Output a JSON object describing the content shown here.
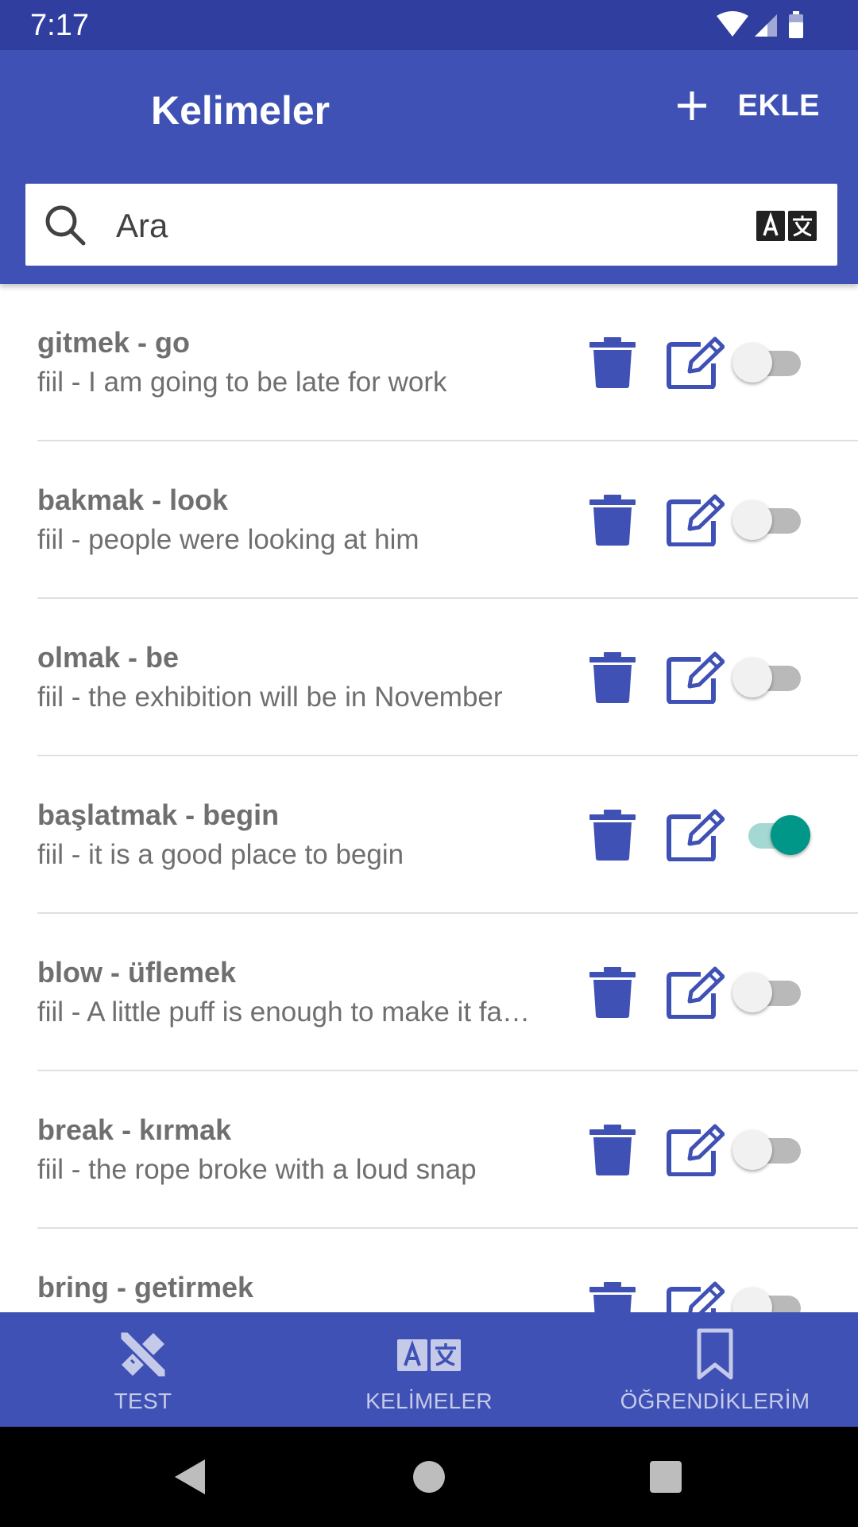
{
  "status_bar": {
    "time": "7:17"
  },
  "app_bar": {
    "title": "Kelimeler",
    "add_label": "EKLE"
  },
  "search": {
    "placeholder": "Ara"
  },
  "words": [
    {
      "title": "gitmek - go",
      "description": "fiil - I am going to be late for work",
      "learned": false
    },
    {
      "title": "bakmak - look",
      "description": "fiil - people were looking at him",
      "learned": false
    },
    {
      "title": "olmak - be",
      "description": "fiil - the exhibition will be in November",
      "learned": false
    },
    {
      "title": "başlatmak - begin",
      "description": "fiil - it is a good place to begin",
      "learned": true
    },
    {
      "title": "blow - üflemek",
      "description": "fiil - A little puff is enough to make it fa…",
      "learned": false
    },
    {
      "title": "break - kırmak",
      "description": "fiil - the rope broke with a loud snap",
      "learned": false
    },
    {
      "title": "bring - getirmek",
      "description": "",
      "learned": false
    }
  ],
  "bottom_nav": {
    "items": [
      {
        "label": "TEST",
        "icon": "pencil-ruler-icon"
      },
      {
        "label": "KELİMELER",
        "icon": "translate-icon"
      },
      {
        "label": "ÖĞRENDİKLERİM",
        "icon": "bookmark-icon"
      }
    ]
  },
  "colors": {
    "primary": "#3f51b5",
    "primary_dark": "#303f9f",
    "accent": "#009688",
    "icon": "#3f51b5",
    "nav_label": "#c5cae9"
  }
}
